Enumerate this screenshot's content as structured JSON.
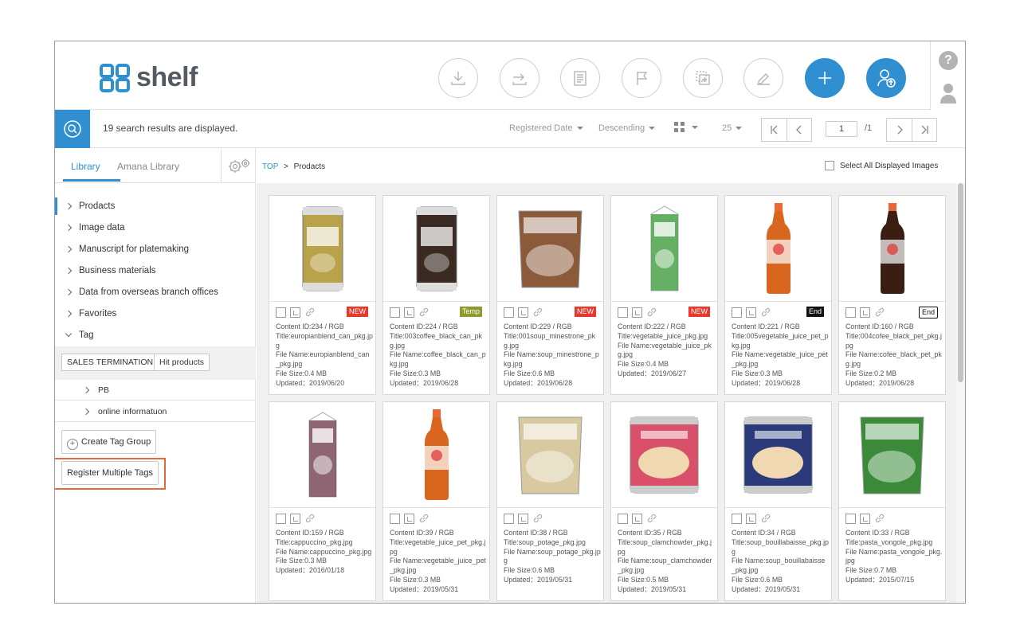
{
  "app": {
    "logo_text": "shelf"
  },
  "header": {
    "buttons": [
      "download-icon",
      "export-icon",
      "document-icon",
      "flag-icon",
      "move-icon",
      "edit-icon",
      "add-icon",
      "user-upload-icon"
    ],
    "help_label": "?"
  },
  "searchbar": {
    "result_text": "19 search results are displayed.",
    "sort_field": "Registered Date",
    "sort_order": "Descending",
    "per_page": "25",
    "page_current": "1",
    "page_total": "/1"
  },
  "sidebar": {
    "tabs": [
      {
        "label": "Library"
      },
      {
        "label": "Amana Library"
      }
    ],
    "tree": [
      {
        "label": "Prodacts"
      },
      {
        "label": "Image data"
      },
      {
        "label": "Manuscript for platemaking"
      },
      {
        "label": "Business materials"
      },
      {
        "label": "Data from overseas branch offices"
      },
      {
        "label": "Favorites"
      },
      {
        "label": "Tag"
      }
    ],
    "tags": [
      "SALES TERMINATION",
      "Hit products"
    ],
    "sub_items": [
      {
        "label": "PB"
      },
      {
        "label": "online informatuon"
      }
    ],
    "create_tag_group": "Create Tag Group",
    "register_multiple": "Register Multiple Tags"
  },
  "content": {
    "breadcrumb_top": "TOP",
    "breadcrumb_sep": ">",
    "breadcrumb_current": "Prodacts",
    "select_all": "Select All Displayed Images"
  },
  "cards": [
    {
      "badge": "NEW",
      "badge_type": "new",
      "thumb": "can",
      "color": "#b9a24a",
      "content_id": "Content ID:234 / RGB",
      "title": "Title:europianblend_can_pkg.jpg",
      "file_name": "File Name:europianblend_can_pkg.jpg",
      "file_size": "File Size:0.4 MB",
      "updated": "Updated：2019/06/20"
    },
    {
      "badge": "Temp",
      "badge_type": "temp",
      "thumb": "can",
      "color": "#3a2a22",
      "content_id": "Content ID:224 / RGB",
      "title": "Title:003coffee_black_can_pkg.jpg",
      "file_name": "File Name:coffee_black_can_pkg.jpg",
      "file_size": "File Size:0.3 MB",
      "updated": "Updated：2019/06/28"
    },
    {
      "badge": "NEW",
      "badge_type": "new",
      "thumb": "pouch",
      "color": "#8a5a3a",
      "content_id": "Content ID:229 / RGB",
      "title": "Title:001soup_minestrone_pkg.jpg",
      "file_name": "File Name:soup_minestrone_pkg.jpg",
      "file_size": "File Size:0.6 MB",
      "updated": "Updated：2019/06/28"
    },
    {
      "badge": "NEW",
      "badge_type": "new",
      "thumb": "carton",
      "color": "#4aa24a",
      "content_id": "Content ID:222 / RGB",
      "title": "Title:vegetable_juice_pkg.jpg",
      "file_name": "File Name:vegetable_juice_pkg.jpg",
      "file_size": "File Size:0.4 MB",
      "updated": "Updated：2019/06/27"
    },
    {
      "badge": "End",
      "badge_type": "end",
      "thumb": "bottle",
      "color": "#d9661e",
      "content_id": "Content ID:221 / RGB",
      "title": "Title:005vegetable_juice_pet_pkg.jpg",
      "file_name": "File Name:vegetable_juice_pet_pkg.jpg",
      "file_size": "File Size:0.3 MB",
      "updated": "Updated：2019/06/28"
    },
    {
      "badge": "End",
      "badge_type": "end-outline",
      "thumb": "bottle",
      "color": "#3a1e14",
      "content_id": "Content ID:160 / RGB",
      "title": "Title:004cofee_black_pet_pkg.jpg",
      "file_name": "File Name:cofee_black_pet_pkg.jpg",
      "file_size": "File Size:0.2 MB",
      "updated": "Updated：2019/06/28"
    },
    {
      "badge": "",
      "badge_type": "",
      "thumb": "carton",
      "color": "#7a4a5a",
      "content_id": "Content ID:159 / RGB",
      "title": "Title:cappuccino_pkg.jpg",
      "file_name": "File Name:cappuccino_pkg.jpg",
      "file_size": "File Size:0.3 MB",
      "updated": "Updated：2016/01/18"
    },
    {
      "badge": "",
      "badge_type": "",
      "thumb": "bottle",
      "color": "#d9661e",
      "content_id": "Content ID:39 / RGB",
      "title": "Title:vegetable_juice_pet_pkg.jpg",
      "file_name": "File Name:vegetable_juice_pet_pkg.jpg",
      "file_size": "File Size:0.3 MB",
      "updated": "Updated：2019/05/31"
    },
    {
      "badge": "",
      "badge_type": "",
      "thumb": "pouch",
      "color": "#d9c9a0",
      "content_id": "Content ID:38 / RGB",
      "title": "Title:soup_potage_pkg.jpg",
      "file_name": "File Name:soup_potage_pkg.jpg",
      "file_size": "File Size:0.6 MB",
      "updated": "Updated：2019/05/31"
    },
    {
      "badge": "",
      "badge_type": "",
      "thumb": "tin",
      "color": "#d9506a",
      "content_id": "Content ID:35 / RGB",
      "title": "Title:soup_clamchowder_pkg.jpg",
      "file_name": "File Name:soup_clamchowder_pkg.jpg",
      "file_size": "File Size:0.5 MB",
      "updated": "Updated：2019/05/31"
    },
    {
      "badge": "",
      "badge_type": "",
      "thumb": "tin",
      "color": "#2a3a7a",
      "content_id": "Content ID:34 / RGB",
      "title": "Title:soup_bouillabaisse_pkg.jpg",
      "file_name": "File Name:soup_bouillabaisse_pkg.jpg",
      "file_size": "File Size:0.6 MB",
      "updated": "Updated：2019/05/31"
    },
    {
      "badge": "",
      "badge_type": "",
      "thumb": "pouch",
      "color": "#3a8a3a",
      "content_id": "Content ID:33 / RGB",
      "title": "Title:pasta_vongole_pkg.jpg",
      "file_name": "File Name:pasta_vongole_pkg.jpg",
      "file_size": "File Size:0.7 MB",
      "updated": "Updated：2015/07/15"
    }
  ],
  "colors": {
    "accent": "#2f8fd1",
    "highlight": "#e8683a",
    "badge_new": "#e8382c",
    "badge_temp": "#8c9b2a"
  }
}
